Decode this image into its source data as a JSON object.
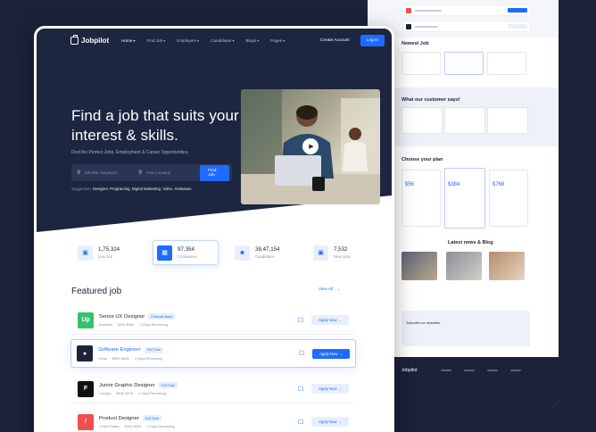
{
  "nav": {
    "logo": "Jobpilot",
    "items": [
      "Home",
      "Find Job",
      "Employers",
      "Candidates",
      "Blogs",
      "Pages"
    ],
    "create_account": "Create Account",
    "login": "Log In"
  },
  "hero": {
    "headline": "Find a job that suits your interest & skills.",
    "subline": "Find the Perfect Jobs, Employment & Career Opportunities.",
    "search_placeholder": "Job title, Keyword...",
    "location_placeholder": "Your Location",
    "find_button": "Find Job",
    "suggestion_label": "Suggestion:",
    "suggestions": [
      "Designer",
      "Programing",
      "Digital Marketing",
      "Video",
      "Animation."
    ]
  },
  "stats": [
    {
      "number": "1,75,324",
      "label": "Live Job",
      "icon": "briefcase-icon"
    },
    {
      "number": "97,354",
      "label": "Companies",
      "icon": "building-icon"
    },
    {
      "number": "38,47,154",
      "label": "Candidates",
      "icon": "users-icon"
    },
    {
      "number": "7,532",
      "label": "New Jobs",
      "icon": "briefcase-icon"
    }
  ],
  "featured": {
    "title": "Featured job",
    "view_all": "View All",
    "jobs": [
      {
        "title": "Senior UX Designer",
        "tag": "Contract Base",
        "location": "Australia",
        "salary": "$30K-$35K",
        "days": "4 Days Remaining",
        "logo_color": "#33c36b",
        "logo_text": "Up"
      },
      {
        "title": "Software Engineer",
        "tag": "Full Time",
        "location": "China",
        "salary": "$50K-$60K",
        "days": "4 Days Remaining",
        "logo_color": "#1b2239",
        "logo_text": ""
      },
      {
        "title": "Junior Graphic Designer",
        "tag": "Full Time",
        "location": "Canada",
        "salary": "$50K-$70K",
        "days": "4 Days Remaining",
        "logo_color": "#111111",
        "logo_text": "F"
      },
      {
        "title": "Product Designer",
        "tag": "Full Time",
        "location": "United States",
        "salary": "$35K-$40K",
        "days": "4 Days Remaining",
        "logo_color": "#ef4f4f",
        "logo_text": "/"
      }
    ],
    "apply_label": "Apply Now"
  },
  "background_page": {
    "newest_job": "Newest Job",
    "customers": "What our customer says!",
    "plan": "Choose your plan",
    "plan_prices": [
      "$56",
      "$384",
      "$768"
    ],
    "news": "Latest news & Blog",
    "newsletter": "Subscribe our newsletter",
    "footer_logo": "Jobpilot"
  },
  "colors": {
    "accent": "#1e6bff",
    "hero_bg": "#1d2640",
    "page_bg": "#1b2239"
  }
}
